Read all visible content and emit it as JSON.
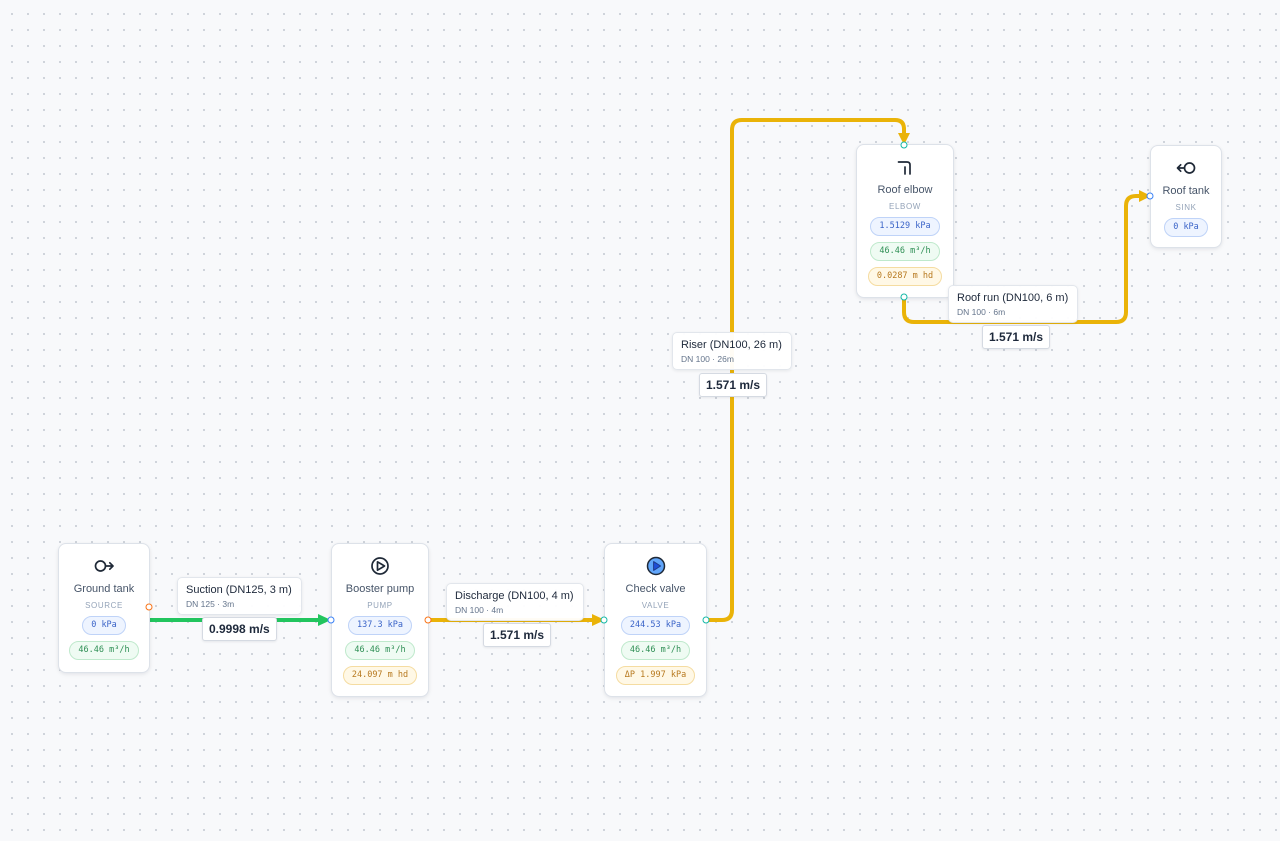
{
  "colors": {
    "pipe_green": "#22c55e",
    "pipe_yellow": "#eab308",
    "handle_orange": "#f97316",
    "handle_blue": "#3b82f6",
    "handle_teal": "#14b8a6"
  },
  "nodes": [
    {
      "id": "ground-tank",
      "icon": "source-arrow-icon",
      "title": "Ground tank",
      "type": "SOURCE",
      "pills": [
        {
          "kind": "pressure",
          "text": "0 kPa"
        },
        {
          "kind": "flow",
          "text": "46.46 m³/h"
        }
      ]
    },
    {
      "id": "booster-pump",
      "icon": "pump-icon",
      "title": "Booster pump",
      "type": "PUMP",
      "pills": [
        {
          "kind": "pressure",
          "text": "137.3 kPa"
        },
        {
          "kind": "flow",
          "text": "46.46 m³/h"
        },
        {
          "kind": "head",
          "text": "24.097 m hd"
        }
      ]
    },
    {
      "id": "check-valve",
      "icon": "play-valve-icon",
      "title": "Check valve",
      "type": "VALVE",
      "pills": [
        {
          "kind": "pressure",
          "text": "244.53 kPa"
        },
        {
          "kind": "flow",
          "text": "46.46 m³/h"
        },
        {
          "kind": "head",
          "text": "ΔP 1.997 kPa"
        }
      ]
    },
    {
      "id": "roof-elbow",
      "icon": "elbow-icon",
      "title": "Roof elbow",
      "type": "ELBOW",
      "pills": [
        {
          "kind": "pressure",
          "text": "1.5129 kPa"
        },
        {
          "kind": "flow",
          "text": "46.46 m³/h"
        },
        {
          "kind": "head",
          "text": "0.0287 m hd"
        }
      ]
    },
    {
      "id": "roof-tank",
      "icon": "sink-arrow-icon",
      "title": "Roof tank",
      "type": "SINK",
      "pills": [
        {
          "kind": "pressure",
          "text": "0 kPa"
        }
      ]
    }
  ],
  "edges": [
    {
      "id": "suction",
      "name": "Suction (DN125, 3 m)",
      "sub": "DN 125 · 3m",
      "velocity": "0.9998 m/s",
      "color": "#22c55e"
    },
    {
      "id": "discharge",
      "name": "Discharge (DN100, 4 m)",
      "sub": "DN 100 · 4m",
      "velocity": "1.571 m/s",
      "color": "#eab308"
    },
    {
      "id": "riser",
      "name": "Riser (DN100, 26 m)",
      "sub": "DN 100 · 26m",
      "velocity": "1.571 m/s",
      "color": "#eab308"
    },
    {
      "id": "roof-run",
      "name": "Roof run (DN100, 6 m)",
      "sub": "DN 100 · 6m",
      "velocity": "1.571 m/s",
      "color": "#eab308"
    }
  ]
}
